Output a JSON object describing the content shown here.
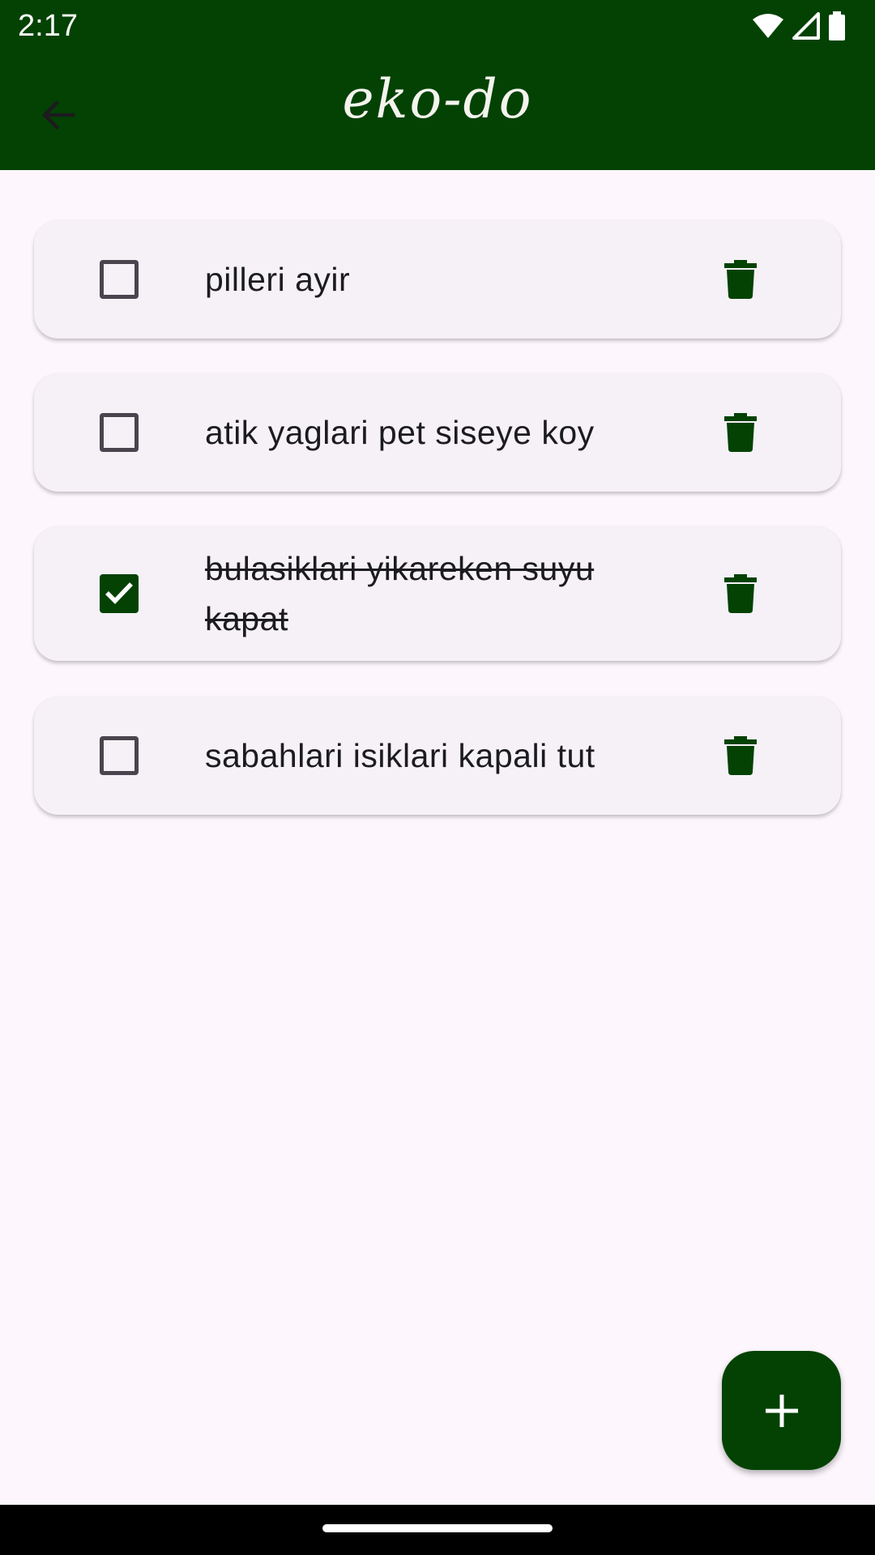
{
  "status_bar": {
    "time": "2:17"
  },
  "app_bar": {
    "title": "eko-do"
  },
  "tasks": [
    {
      "text": "pilleri ayir",
      "checked": false
    },
    {
      "text": "atik yaglari pet siseye koy",
      "checked": false
    },
    {
      "text": "bulasiklari yikareken suyu kapat",
      "checked": true
    },
    {
      "text": "sabahlari isiklari kapali tut",
      "checked": false
    }
  ],
  "icons": {
    "back": "arrow-left-icon",
    "delete": "trash-icon",
    "add": "plus-icon",
    "check": "check-icon"
  },
  "colors": {
    "primary": "#034203",
    "background": "#fdf7fd",
    "card": "#f5f1f7",
    "text": "#1c1b1f"
  }
}
